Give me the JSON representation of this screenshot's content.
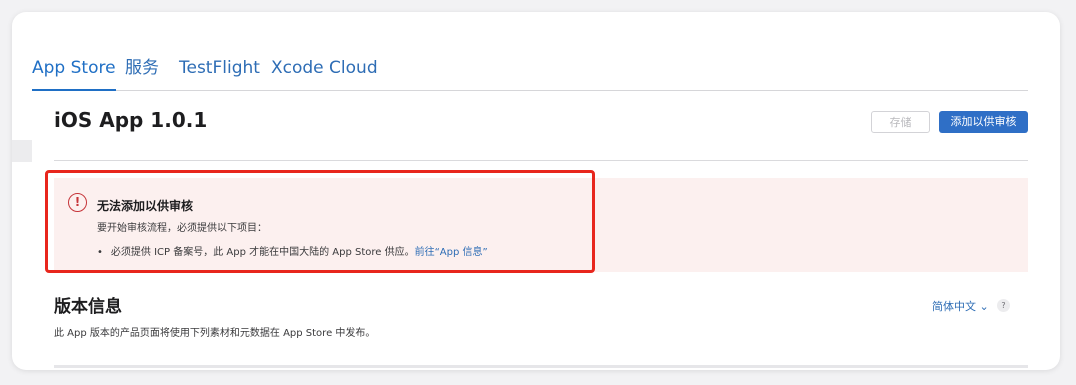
{
  "tabs": [
    {
      "label": "App Store",
      "active": true
    },
    {
      "label": "服务"
    },
    {
      "label": "TestFlight"
    },
    {
      "label": "Xcode Cloud"
    }
  ],
  "header": {
    "title": "iOS App 1.0.1",
    "save_label": "存储",
    "submit_label": "添加以供审核"
  },
  "alert": {
    "icon": "exclamation-circle-icon",
    "icon_glyph": "!",
    "title": "无法添加以供审核",
    "description": "要开始审核流程，必须提供以下项目：",
    "bullet": "必须提供 ICP 备案号，此 App 才能在中国大陆的 App Store 供应。",
    "link": "前往“App 信息”",
    "color": "#c6353a"
  },
  "version_info": {
    "title": "版本信息",
    "language": "简体中文 ⌄",
    "help": "?",
    "description": "此 App 版本的产品页面将使用下列素材和元数据在 App Store 中发布。"
  },
  "colors": {
    "accent": "#2f6fc6",
    "alert_bg": "#fcf0ef",
    "highlight": "#e8261d"
  }
}
